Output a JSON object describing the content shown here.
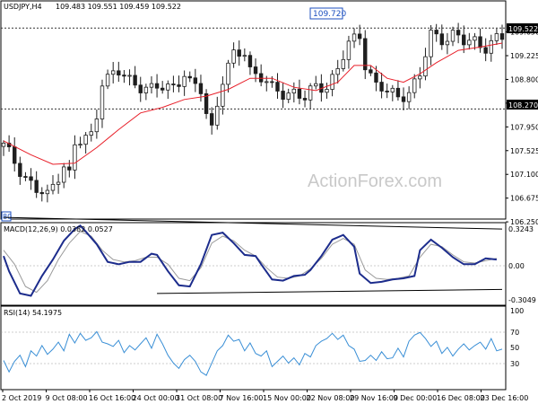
{
  "header": {
    "symbol_timeframe": "USDJPY,H4",
    "quote": "109.483 109.551 109.459 109.522"
  },
  "watermark": "ActionForex.com",
  "colors": {
    "candle": "#1f1f1f",
    "ma": "#e8202a",
    "macd": "#1c2c8c",
    "signal": "#9a9a9a",
    "rsi": "#3a8fd6",
    "trend": "#000000",
    "watermark": "#c9c9c9"
  },
  "chart_data": [
    {
      "type": "candlestick",
      "title": "USDJPY,H4 109.483 109.551 109.459 109.522",
      "ylim": [
        106.3,
        109.9
      ],
      "yticks": [
        "109.650",
        "109.225",
        "108.800",
        "108.375",
        "107.950",
        "107.525",
        "107.100",
        "106.675",
        "106.250"
      ],
      "current_price_label": "109.522",
      "level_lines": [
        {
          "value": 109.72,
          "label": "109.720",
          "style": "dashed"
        },
        {
          "value": 108.27,
          "label": "108.270",
          "style": "dashed"
        }
      ],
      "left_low_label": "80",
      "x_ticks": [
        "2 Oct 2019",
        "9 Oct 08:00",
        "16 Oct 16:00",
        "24 Oct 00:00",
        "31 Oct 08:00",
        "7 Nov 16:00",
        "15 Nov 00:00",
        "22 Nov 08:00",
        "29 Nov 16:00",
        "9 Dec 00:00",
        "16 Dec 08:00",
        "23 Dec 16:00"
      ],
      "close_path": [
        [
          0,
          107.6
        ],
        [
          3,
          107.2
        ],
        [
          6,
          106.8
        ],
        [
          8,
          106.7
        ],
        [
          11,
          107.3
        ],
        [
          12,
          107.1
        ],
        [
          13,
          107.6
        ],
        [
          16,
          107.8
        ],
        [
          17,
          108.2
        ],
        [
          18,
          108.8
        ],
        [
          21,
          108.9
        ],
        [
          24,
          108.75
        ],
        [
          27,
          108.6
        ],
        [
          31,
          108.7
        ],
        [
          33,
          108.9
        ],
        [
          34,
          108.7
        ],
        [
          36,
          108.6
        ],
        [
          37,
          108.2
        ],
        [
          38,
          107.95
        ],
        [
          39,
          108.4
        ],
        [
          40,
          108.8
        ],
        [
          42,
          109.2
        ],
        [
          44,
          109.3
        ],
        [
          45,
          109.0
        ],
        [
          47,
          108.85
        ],
        [
          49,
          108.6
        ],
        [
          51,
          108.55
        ],
        [
          53,
          108.6
        ],
        [
          55,
          108.45
        ],
        [
          57,
          108.65
        ],
        [
          59,
          108.7
        ],
        [
          61,
          109.0
        ],
        [
          63,
          109.4
        ],
        [
          65,
          109.6
        ],
        [
          66,
          109.1
        ],
        [
          68,
          108.7
        ],
        [
          70,
          108.55
        ],
        [
          72,
          108.5
        ],
        [
          74,
          108.6
        ],
        [
          76,
          108.85
        ],
        [
          78,
          109.6
        ],
        [
          80,
          109.55
        ],
        [
          82,
          109.6
        ],
        [
          84,
          109.45
        ],
        [
          86,
          109.5
        ],
        [
          88,
          109.4
        ],
        [
          90,
          109.5
        ],
        [
          91,
          109.52
        ]
      ],
      "ma_path": [
        [
          0,
          107.7
        ],
        [
          5,
          107.45
        ],
        [
          9,
          107.28
        ],
        [
          13,
          107.3
        ],
        [
          17,
          107.58
        ],
        [
          21,
          107.9
        ],
        [
          25,
          108.2
        ],
        [
          29,
          108.3
        ],
        [
          33,
          108.44
        ],
        [
          37,
          108.5
        ],
        [
          41,
          108.62
        ],
        [
          45,
          108.82
        ],
        [
          49,
          108.82
        ],
        [
          53,
          108.66
        ],
        [
          57,
          108.6
        ],
        [
          61,
          108.75
        ],
        [
          64,
          109.05
        ],
        [
          67,
          109.05
        ],
        [
          70,
          108.82
        ],
        [
          73,
          108.75
        ],
        [
          76,
          108.9
        ],
        [
          79,
          109.1
        ],
        [
          83,
          109.32
        ],
        [
          87,
          109.38
        ],
        [
          91,
          109.45
        ]
      ]
    },
    {
      "type": "line",
      "title": "MACD(12,26,9) 0.0382 0.0527",
      "ylim": [
        -0.3349,
        0.3243
      ],
      "yticks": [
        "0.3243",
        "0.00",
        "-0.3049"
      ],
      "series": [
        {
          "name": "MACD",
          "values": [
            [
              0,
              0.07
            ],
            [
              1,
              -0.06
            ],
            [
              3,
              -0.25
            ],
            [
              5,
              -0.27
            ],
            [
              7,
              -0.1
            ],
            [
              9,
              0.04
            ],
            [
              11,
              0.2
            ],
            [
              13,
              0.3
            ],
            [
              14,
              0.33
            ],
            [
              15,
              0.28
            ],
            [
              17,
              0.17
            ],
            [
              19,
              0.02
            ],
            [
              21,
              0.0
            ],
            [
              23,
              0.02
            ],
            [
              25,
              0.02
            ],
            [
              27,
              0.09
            ],
            [
              28,
              0.08
            ],
            [
              30,
              -0.06
            ],
            [
              32,
              -0.18
            ],
            [
              34,
              -0.19
            ],
            [
              36,
              0.0
            ],
            [
              38,
              0.25
            ],
            [
              40,
              0.27
            ],
            [
              42,
              0.18
            ],
            [
              44,
              0.08
            ],
            [
              46,
              0.07
            ],
            [
              47,
              0.0
            ],
            [
              49,
              -0.13
            ],
            [
              51,
              -0.14
            ],
            [
              53,
              -0.1
            ],
            [
              55,
              -0.09
            ],
            [
              56,
              -0.05
            ],
            [
              58,
              0.07
            ],
            [
              60,
              0.21
            ],
            [
              62,
              0.25
            ],
            [
              64,
              0.15
            ],
            [
              65,
              -0.08
            ],
            [
              67,
              -0.16
            ],
            [
              69,
              -0.15
            ],
            [
              71,
              -0.13
            ],
            [
              73,
              -0.12
            ],
            [
              75,
              -0.1
            ],
            [
              76,
              0.12
            ],
            [
              78,
              0.21
            ],
            [
              80,
              0.14
            ],
            [
              82,
              0.06
            ],
            [
              84,
              0.0
            ],
            [
              86,
              0.0
            ],
            [
              88,
              0.05
            ],
            [
              90,
              0.04
            ]
          ]
        },
        {
          "name": "Signal",
          "values": [
            [
              0,
              0.12
            ],
            [
              2,
              0.0
            ],
            [
              4,
              -0.19
            ],
            [
              6,
              -0.24
            ],
            [
              8,
              -0.14
            ],
            [
              10,
              0.04
            ],
            [
              12,
              0.18
            ],
            [
              14,
              0.28
            ],
            [
              16,
              0.24
            ],
            [
              18,
              0.12
            ],
            [
              20,
              0.04
            ],
            [
              22,
              0.02
            ],
            [
              24,
              0.03
            ],
            [
              26,
              0.06
            ],
            [
              28,
              0.06
            ],
            [
              30,
              0.0
            ],
            [
              32,
              -0.12
            ],
            [
              34,
              -0.14
            ],
            [
              36,
              -0.03
            ],
            [
              38,
              0.18
            ],
            [
              40,
              0.24
            ],
            [
              42,
              0.2
            ],
            [
              44,
              0.12
            ],
            [
              46,
              0.07
            ],
            [
              48,
              -0.03
            ],
            [
              50,
              -0.11
            ],
            [
              52,
              -0.12
            ],
            [
              54,
              -0.1
            ],
            [
              56,
              -0.04
            ],
            [
              58,
              0.05
            ],
            [
              60,
              0.17
            ],
            [
              62,
              0.22
            ],
            [
              64,
              0.17
            ],
            [
              66,
              -0.05
            ],
            [
              68,
              -0.12
            ],
            [
              70,
              -0.13
            ],
            [
              72,
              -0.12
            ],
            [
              74,
              -0.1
            ],
            [
              76,
              0.06
            ],
            [
              78,
              0.17
            ],
            [
              80,
              0.15
            ],
            [
              82,
              0.08
            ],
            [
              84,
              0.02
            ],
            [
              86,
              0.01
            ],
            [
              88,
              0.03
            ],
            [
              90,
              0.05
            ]
          ]
        }
      ],
      "trendlines": [
        [
          [
            0,
            0.4
          ],
          [
            91,
            0.3
          ]
        ],
        [
          [
            28,
            -0.25
          ],
          [
            91,
            -0.215
          ]
        ]
      ]
    },
    {
      "type": "line",
      "title": "RSI(14) 54.1975",
      "ylim": [
        0,
        100
      ],
      "yticks": [
        "100",
        "70",
        "50",
        "30"
      ],
      "levels": [
        70,
        30
      ],
      "series": [
        {
          "name": "RSI",
          "values": [
            [
              0,
              41
            ],
            [
              1,
              28
            ],
            [
              2,
              40
            ],
            [
              3,
              47
            ],
            [
              4,
              34
            ],
            [
              5,
              52
            ],
            [
              6,
              46
            ],
            [
              7,
              58
            ],
            [
              8,
              48
            ],
            [
              9,
              54
            ],
            [
              10,
              62
            ],
            [
              11,
              52
            ],
            [
              12,
              71
            ],
            [
              13,
              61
            ],
            [
              14,
              72
            ],
            [
              15,
              64
            ],
            [
              16,
              67
            ],
            [
              17,
              74
            ],
            [
              18,
              62
            ],
            [
              19,
              60
            ],
            [
              20,
              57
            ],
            [
              21,
              64
            ],
            [
              22,
              50
            ],
            [
              23,
              58
            ],
            [
              24,
              53
            ],
            [
              25,
              60
            ],
            [
              26,
              67
            ],
            [
              27,
              55
            ],
            [
              28,
              71
            ],
            [
              29,
              60
            ],
            [
              30,
              47
            ],
            [
              31,
              38
            ],
            [
              32,
              32
            ],
            [
              33,
              42
            ],
            [
              34,
              47
            ],
            [
              35,
              40
            ],
            [
              36,
              28
            ],
            [
              37,
              24
            ],
            [
              38,
              38
            ],
            [
              39,
              52
            ],
            [
              40,
              58
            ],
            [
              41,
              70
            ],
            [
              42,
              63
            ],
            [
              43,
              65
            ],
            [
              44,
              52
            ],
            [
              45,
              61
            ],
            [
              46,
              49
            ],
            [
              47,
              46
            ],
            [
              48,
              52
            ],
            [
              49,
              34
            ],
            [
              50,
              40
            ],
            [
              51,
              46
            ],
            [
              52,
              38
            ],
            [
              53,
              44
            ],
            [
              54,
              36
            ],
            [
              55,
              49
            ],
            [
              56,
              45
            ],
            [
              57,
              58
            ],
            [
              58,
              63
            ],
            [
              59,
              66
            ],
            [
              60,
              72
            ],
            [
              61,
              65
            ],
            [
              62,
              70
            ],
            [
              63,
              58
            ],
            [
              64,
              54
            ],
            [
              65,
              40
            ],
            [
              66,
              41
            ],
            [
              67,
              47
            ],
            [
              68,
              41
            ],
            [
              69,
              51
            ],
            [
              70,
              43
            ],
            [
              71,
              44
            ],
            [
              72,
              55
            ],
            [
              73,
              45
            ],
            [
              74,
              63
            ],
            [
              75,
              70
            ],
            [
              76,
              73
            ],
            [
              77,
              66
            ],
            [
              78,
              57
            ],
            [
              79,
              63
            ],
            [
              80,
              49
            ],
            [
              81,
              56
            ],
            [
              82,
              46
            ],
            [
              83,
              54
            ],
            [
              84,
              60
            ],
            [
              85,
              53
            ],
            [
              86,
              58
            ],
            [
              87,
              62
            ],
            [
              88,
              54
            ],
            [
              89,
              66
            ],
            [
              90,
              52
            ],
            [
              91,
              54
            ]
          ]
        }
      ]
    }
  ]
}
